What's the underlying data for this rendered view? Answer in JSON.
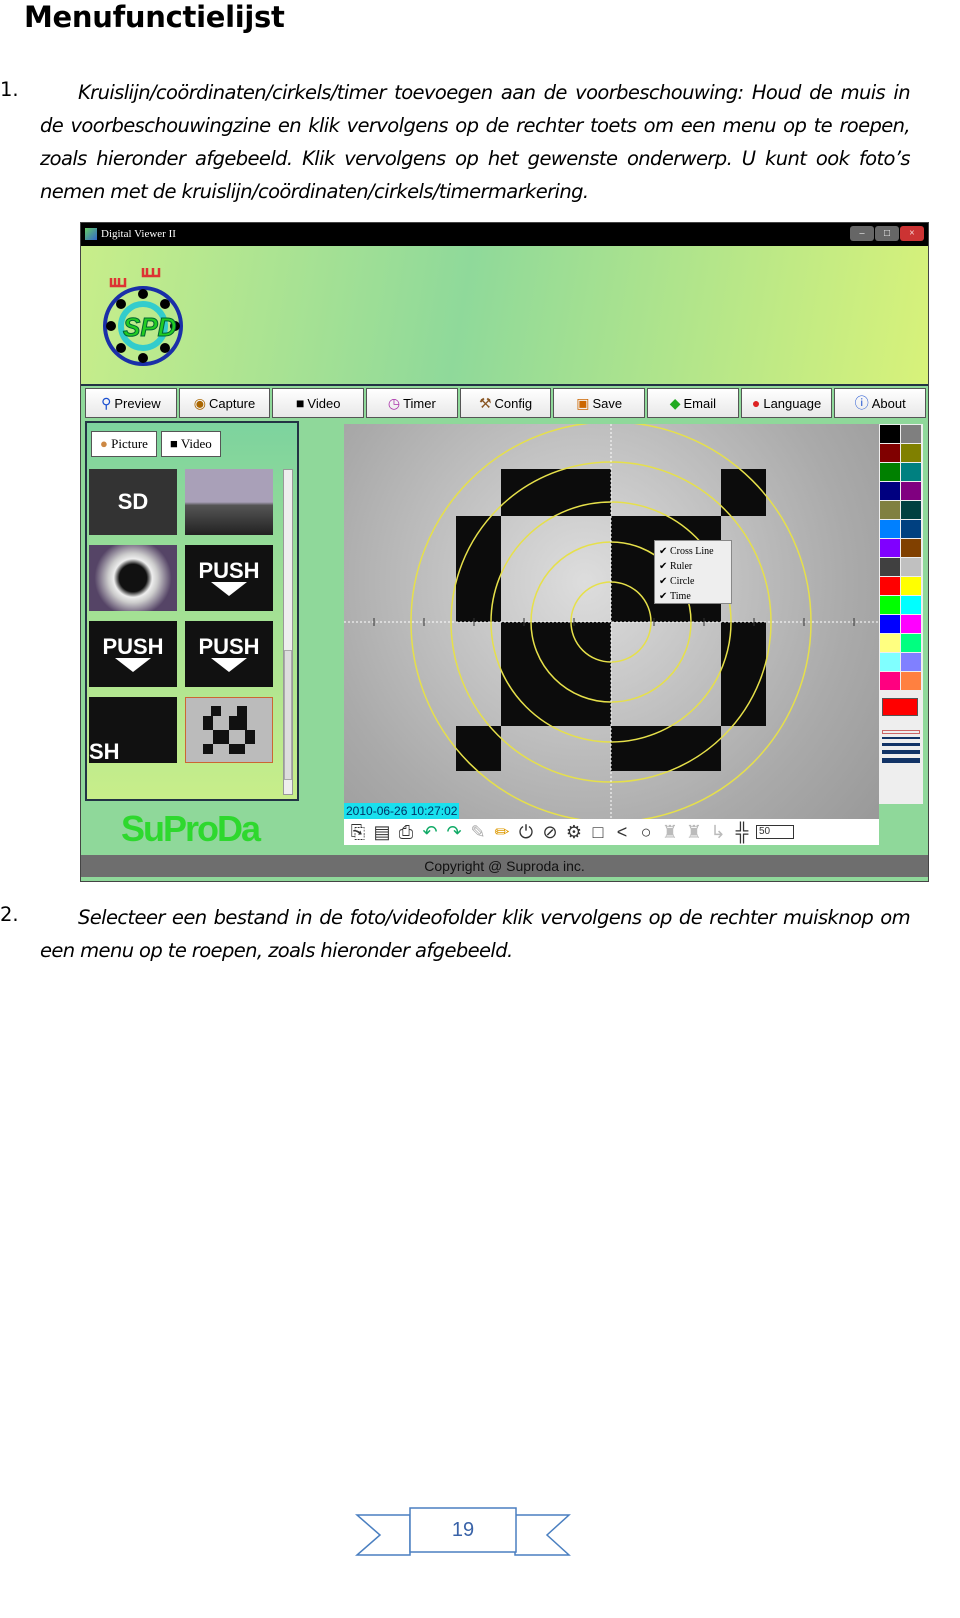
{
  "heading": "Menufunctielijst",
  "items": [
    {
      "number": "1.",
      "text": "Kruislijn/coördinaten/cirkels/timer toevoegen aan de voorbeschouwing: Houd de muis in de voorbeschouwingzine en klik vervolgens op de rechter toets om een menu op te roepen, zoals hieronder afgebeeld. Klik vervolgens op het gewenste onderwerp. U kunt ook foto’s nemen met de kruislijn/coördinaten/cirkels/timermarkering."
    },
    {
      "number": "2.",
      "text": "Selecteer een bestand in de foto/videofolder klik vervolgens op de rechter muisknop om een menu op te roepen, zoals hieronder afgebeeld."
    }
  ],
  "screenshot": {
    "window_title": "Digital Viewer II",
    "logo_text": "SPD",
    "tabs": [
      {
        "label": "Preview",
        "icon": "magnifier-icon"
      },
      {
        "label": "Capture",
        "icon": "camera-icon"
      },
      {
        "label": "Video",
        "icon": "video-camera-icon"
      },
      {
        "label": "Timer",
        "icon": "clock-icon"
      },
      {
        "label": "Config",
        "icon": "hammer-icon"
      },
      {
        "label": "Save",
        "icon": "floppy-icon"
      },
      {
        "label": "Email",
        "icon": "email-icon"
      },
      {
        "label": "Language",
        "icon": "lips-icon"
      },
      {
        "label": "About",
        "icon": "info-icon"
      }
    ],
    "subtabs": [
      "Picture",
      "Video"
    ],
    "thumbnails": [
      "SD",
      "",
      "",
      "PUSH",
      "PUSH",
      "PUSH",
      "SH",
      ""
    ],
    "context_menu": [
      {
        "label": "Cross Line",
        "checked": true
      },
      {
        "label": "Ruler",
        "checked": true
      },
      {
        "label": "Circle",
        "checked": true
      },
      {
        "label": "Time",
        "checked": true
      }
    ],
    "timestamp": "2010-06-26 10:27:02",
    "zoom_value": "50",
    "brand": "SuProDa",
    "status": "Copyright @ Suproda inc.",
    "palette": [
      "#000000",
      "#7f7f7f",
      "#800000",
      "#808000",
      "#008000",
      "#008080",
      "#000080",
      "#800080",
      "#808040",
      "#004040",
      "#0080ff",
      "#004080",
      "#8000ff",
      "#804000",
      "#404040",
      "#c0c0c0",
      "#ff0000",
      "#ffff00",
      "#00ff00",
      "#00ffff",
      "#0000ff",
      "#ff00ff",
      "#ffff80",
      "#00ff80",
      "#80ffff",
      "#8080ff",
      "#ff0080",
      "#ff8040"
    ],
    "selected_color": "#ff0000"
  },
  "page_number": "19"
}
